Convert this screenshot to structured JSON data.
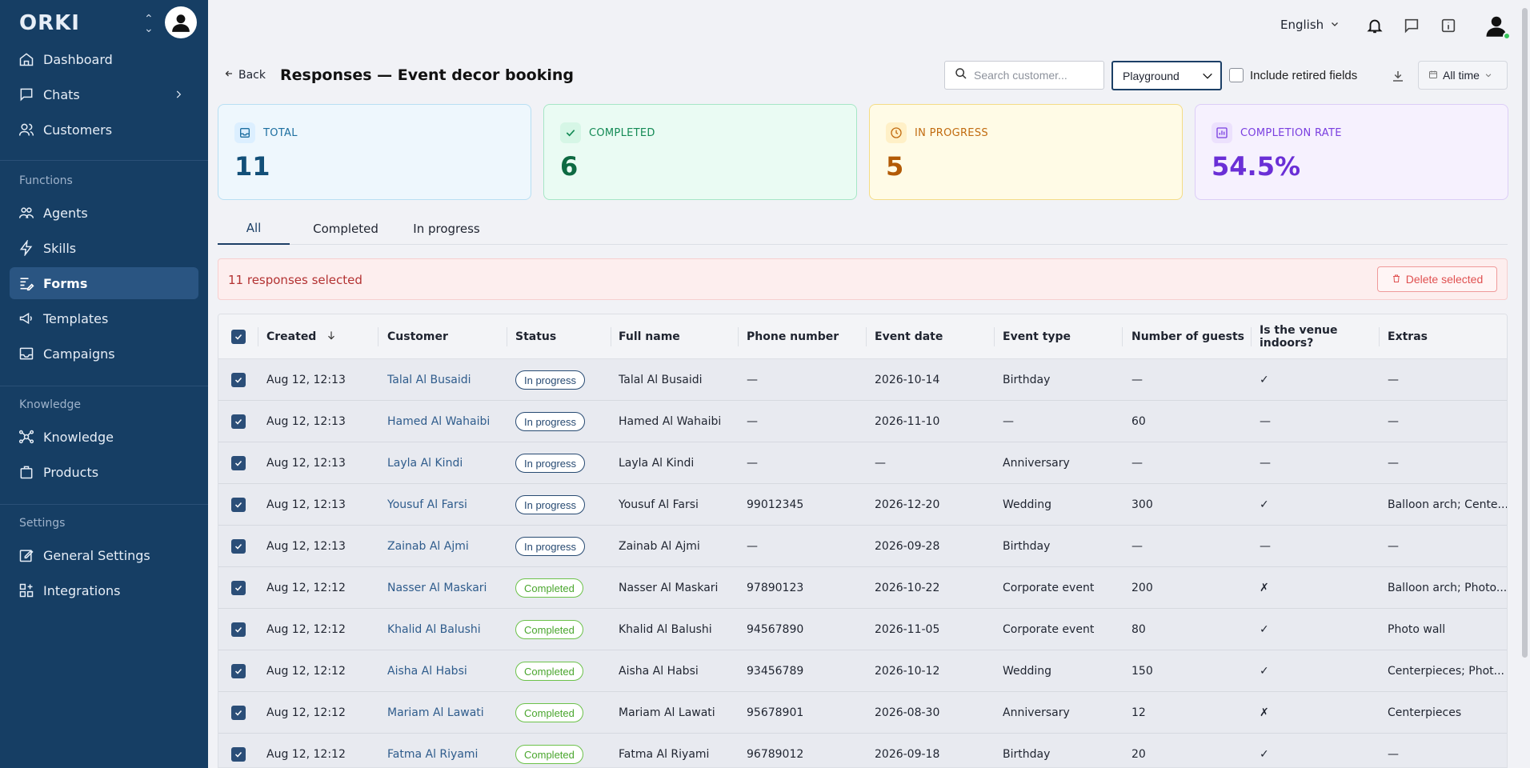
{
  "sidebar": {
    "brand": "ORKI",
    "items": [
      {
        "label": "Dashboard",
        "icon": "home-icon"
      },
      {
        "label": "Chats",
        "icon": "chat-icon"
      },
      {
        "label": "Customers",
        "icon": "users-icon"
      },
      {
        "label": "Agents",
        "icon": "agents-icon"
      },
      {
        "label": "Skills",
        "icon": "bolt-icon"
      },
      {
        "label": "Forms",
        "icon": "forms-icon"
      },
      {
        "label": "Templates",
        "icon": "megaphone-icon"
      },
      {
        "label": "Campaigns",
        "icon": "mail-icon"
      },
      {
        "label": "Knowledge",
        "icon": "network-icon"
      },
      {
        "label": "Products",
        "icon": "bag-icon"
      },
      {
        "label": "General Settings",
        "icon": "edit-icon"
      },
      {
        "label": "Integrations",
        "icon": "grid-plus-icon"
      }
    ],
    "sections": {
      "functions": "Functions",
      "knowledge": "Knowledge",
      "settings": "Settings"
    }
  },
  "topbar": {
    "language": "English"
  },
  "header": {
    "back": "Back",
    "title": "Responses — Event decor booking",
    "search_placeholder": "Search customer...",
    "environment": "Playground",
    "include_retired": "Include retired fields",
    "range": "All time"
  },
  "stats": {
    "total": {
      "label": "TOTAL",
      "value": "11"
    },
    "completed": {
      "label": "COMPLETED",
      "value": "6"
    },
    "in_progress": {
      "label": "IN PROGRESS",
      "value": "5"
    },
    "rate": {
      "label": "COMPLETION RATE",
      "value": "54.5%"
    }
  },
  "tabs": [
    {
      "label": "All"
    },
    {
      "label": "Completed"
    },
    {
      "label": "In progress"
    }
  ],
  "selection": {
    "text": "11 responses selected",
    "delete": "Delete selected"
  },
  "table": {
    "columns": [
      "Created",
      "Customer",
      "Status",
      "Full name",
      "Phone number",
      "Event date",
      "Event type",
      "Number of guests",
      "Is the venue indoors?",
      "Extras"
    ],
    "rows": [
      {
        "created": "Aug 12, 12:13",
        "customer": "Talal Al Busaidi",
        "status": "In progress",
        "name": "Talal Al Busaidi",
        "phone": "—",
        "date": "2026-10-14",
        "type": "Birthday",
        "guests": "—",
        "indoors": "✓",
        "extras": "—"
      },
      {
        "created": "Aug 12, 12:13",
        "customer": "Hamed Al Wahaibi",
        "status": "In progress",
        "name": "Hamed Al Wahaibi",
        "phone": "—",
        "date": "2026-11-10",
        "type": "—",
        "guests": "60",
        "indoors": "—",
        "extras": "—"
      },
      {
        "created": "Aug 12, 12:13",
        "customer": "Layla Al Kindi",
        "status": "In progress",
        "name": "Layla Al Kindi",
        "phone": "—",
        "date": "—",
        "type": "Anniversary",
        "guests": "—",
        "indoors": "—",
        "extras": "—"
      },
      {
        "created": "Aug 12, 12:13",
        "customer": "Yousuf Al Farsi",
        "status": "In progress",
        "name": "Yousuf Al Farsi",
        "phone": "99012345",
        "date": "2026-12-20",
        "type": "Wedding",
        "guests": "300",
        "indoors": "✓",
        "extras": "Balloon arch; Cente..."
      },
      {
        "created": "Aug 12, 12:13",
        "customer": "Zainab Al Ajmi",
        "status": "In progress",
        "name": "Zainab Al Ajmi",
        "phone": "—",
        "date": "2026-09-28",
        "type": "Birthday",
        "guests": "—",
        "indoors": "—",
        "extras": "—"
      },
      {
        "created": "Aug 12, 12:12",
        "customer": "Nasser Al Maskari",
        "status": "Completed",
        "name": "Nasser Al Maskari",
        "phone": "97890123",
        "date": "2026-10-22",
        "type": "Corporate event",
        "guests": "200",
        "indoors": "✗",
        "extras": "Balloon arch; Photo..."
      },
      {
        "created": "Aug 12, 12:12",
        "customer": "Khalid Al Balushi",
        "status": "Completed",
        "name": "Khalid Al Balushi",
        "phone": "94567890",
        "date": "2026-11-05",
        "type": "Corporate event",
        "guests": "80",
        "indoors": "✓",
        "extras": "Photo wall"
      },
      {
        "created": "Aug 12, 12:12",
        "customer": "Aisha Al Habsi",
        "status": "Completed",
        "name": "Aisha Al Habsi",
        "phone": "93456789",
        "date": "2026-10-12",
        "type": "Wedding",
        "guests": "150",
        "indoors": "✓",
        "extras": "Centerpieces; Phot..."
      },
      {
        "created": "Aug 12, 12:12",
        "customer": "Mariam Al Lawati",
        "status": "Completed",
        "name": "Mariam Al Lawati",
        "phone": "95678901",
        "date": "2026-08-30",
        "type": "Anniversary",
        "guests": "12",
        "indoors": "✗",
        "extras": "Centerpieces"
      },
      {
        "created": "Aug 12, 12:12",
        "customer": "Fatma Al Riyami",
        "status": "Completed",
        "name": "Fatma Al Riyami",
        "phone": "96789012",
        "date": "2026-09-18",
        "type": "Birthday",
        "guests": "20",
        "indoors": "✓",
        "extras": "—"
      }
    ]
  },
  "colors": {
    "sidebar": "#163e64",
    "accent": "#1c3f66",
    "completed": "#6cc24a",
    "danger": "#e05050"
  }
}
